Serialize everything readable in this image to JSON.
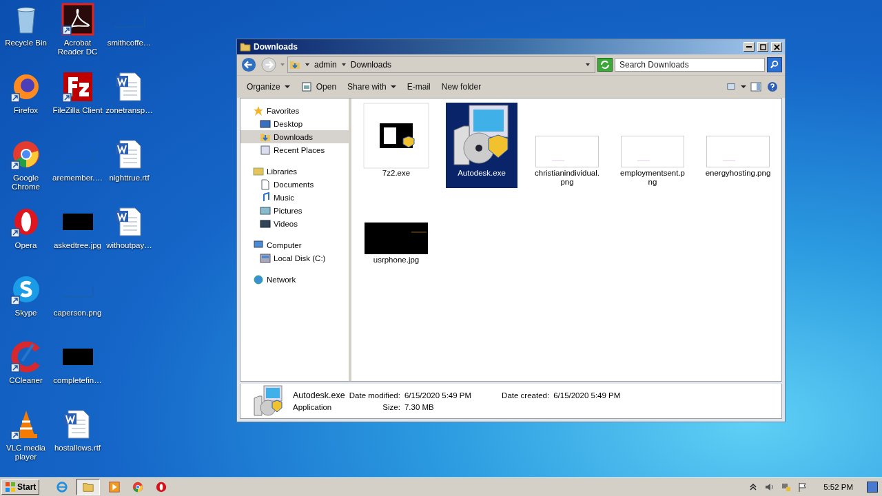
{
  "desktop_icons": [
    {
      "label": "Recycle Bin",
      "kind": "recycle",
      "shortcut": false
    },
    {
      "label": "Firefox",
      "kind": "firefox",
      "shortcut": true
    },
    {
      "label": "Google Chrome",
      "kind": "chrome",
      "shortcut": true
    },
    {
      "label": "Opera",
      "kind": "opera",
      "shortcut": true
    },
    {
      "label": "Skype",
      "kind": "skype",
      "shortcut": true
    },
    {
      "label": "CCleaner",
      "kind": "ccleaner",
      "shortcut": true
    },
    {
      "label": "VLC media player",
      "kind": "vlc",
      "shortcut": true
    },
    {
      "label": "Acrobat Reader DC",
      "kind": "acrobat",
      "shortcut": true
    },
    {
      "label": "FileZilla Client",
      "kind": "filezilla",
      "shortcut": true
    },
    {
      "label": "aremember.…",
      "kind": "blank",
      "shortcut": false
    },
    {
      "label": "askedtree.jpg",
      "kind": "black",
      "shortcut": false
    },
    {
      "label": "caperson.png",
      "kind": "blank",
      "shortcut": false
    },
    {
      "label": "completefin…",
      "kind": "black",
      "shortcut": false
    },
    {
      "label": "hostallows.rtf",
      "kind": "word",
      "shortcut": false
    },
    {
      "label": "smithcoffe…",
      "kind": "blank",
      "shortcut": false
    },
    {
      "label": "zonetransp…",
      "kind": "word",
      "shortcut": false
    },
    {
      "label": "nighttrue.rtf",
      "kind": "word",
      "shortcut": false
    },
    {
      "label": "withoutpay…",
      "kind": "word",
      "shortcut": false
    }
  ],
  "window": {
    "title": "Downloads",
    "address": {
      "crumbs": [
        "admin",
        "Downloads"
      ],
      "search_placeholder": "Search Downloads"
    },
    "toolbar": [
      {
        "label": "Organize",
        "dropdown": true,
        "kind": "text"
      },
      {
        "label": "Open",
        "dropdown": false,
        "kind": "open"
      },
      {
        "label": "Share with",
        "dropdown": true,
        "kind": "text"
      },
      {
        "label": "E-mail",
        "dropdown": false,
        "kind": "text"
      },
      {
        "label": "New folder",
        "dropdown": false,
        "kind": "text"
      }
    ],
    "nav": [
      {
        "label": "Favorites",
        "kind": "star",
        "selected": false,
        "children": [
          {
            "label": "Desktop",
            "kind": "desktop",
            "selected": false
          },
          {
            "label": "Downloads",
            "kind": "downloads",
            "selected": true
          },
          {
            "label": "Recent Places",
            "kind": "recent",
            "selected": false
          }
        ]
      },
      {
        "label": "Libraries",
        "kind": "libraries",
        "selected": false,
        "children": [
          {
            "label": "Documents",
            "kind": "documents",
            "selected": false
          },
          {
            "label": "Music",
            "kind": "music",
            "selected": false
          },
          {
            "label": "Pictures",
            "kind": "pictures",
            "selected": false
          },
          {
            "label": "Videos",
            "kind": "videos",
            "selected": false
          }
        ]
      },
      {
        "label": "Computer",
        "kind": "computer",
        "selected": false,
        "children": [
          {
            "label": "Local Disk (C:)",
            "kind": "disk",
            "selected": false
          }
        ]
      },
      {
        "label": "Network",
        "kind": "network",
        "selected": false
      }
    ],
    "files": [
      {
        "name": "7z2.exe",
        "kind": "sevenzip",
        "selected": false
      },
      {
        "name": "Autodesk.exe",
        "kind": "installer",
        "selected": true
      },
      {
        "name": "christianindividual.png",
        "kind": "white",
        "selected": false
      },
      {
        "name": "employmentsent.png",
        "kind": "white",
        "selected": false
      },
      {
        "name": "energyhosting.png",
        "kind": "white",
        "selected": false
      },
      {
        "name": "usrphone.jpg",
        "kind": "black",
        "selected": false
      }
    ],
    "details": {
      "name": "Autodesk.exe",
      "type": "Application",
      "fields": [
        {
          "label": "Date modified:",
          "value": "6/15/2020 5:49 PM"
        },
        {
          "label": "Date created:",
          "value": "6/15/2020 5:49 PM"
        },
        {
          "label": "Size:",
          "value": "7.30 MB"
        }
      ]
    }
  },
  "taskbar": {
    "start": "Start",
    "apps": [
      {
        "kind": "ie",
        "active": false
      },
      {
        "kind": "explorer",
        "active": true
      },
      {
        "kind": "media",
        "active": false
      },
      {
        "kind": "chrome",
        "active": false
      },
      {
        "kind": "opera",
        "active": false
      }
    ],
    "clock": "5:52 PM"
  }
}
